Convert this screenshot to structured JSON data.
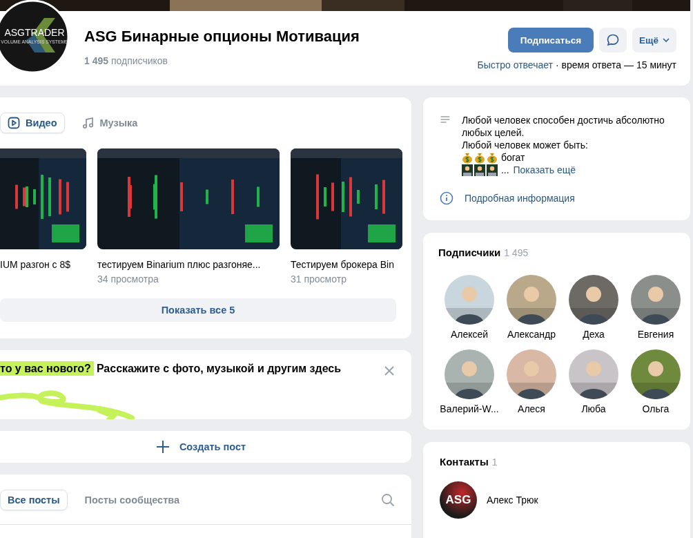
{
  "group": {
    "logo_text": "ASGTRADER",
    "logo_subtext": "VOLUME ANALYSIS SYSTEMS",
    "title": "ASG Бинарные опционы Мотивация",
    "members_count": "1 495",
    "members_label": "подписчиков",
    "subscribe": "Подписаться",
    "more": "Ещё",
    "reply_speed": "Быстро отвечает",
    "reply_time": "· время ответа — 15 минут"
  },
  "media": {
    "tabs": [
      {
        "label": "Видео",
        "kind": "video",
        "selected": true
      },
      {
        "label": "Музыка",
        "kind": "music",
        "selected": false
      }
    ],
    "videos": [
      {
        "title": "IUM разгон с 8$"
      },
      {
        "title": "тестируем Binarium плюс разгоняе...",
        "views": "34 просмотра"
      },
      {
        "title": "Тестируем брокера Bin",
        "views": "31 просмотр"
      }
    ],
    "show_all": "Показать все 5"
  },
  "prompt": {
    "highlight": "то у вас нового?",
    "text": "Расскажите с фото, музыкой и другим здесь"
  },
  "create_post": "Создать пост",
  "post_tabs": [
    {
      "label": "Все посты",
      "selected": true
    },
    {
      "label": "Посты сообщества",
      "selected": false
    }
  ],
  "about": {
    "text": "Любой человек способен достичь абсолютно любых целей.\nЛюбой человек может быть:",
    "emoji_lines": [
      {
        "icons": [
          {
            "kind": "money-bag"
          },
          {
            "kind": "money-bag"
          },
          {
            "kind": "money-bag"
          }
        ],
        "text": "богат"
      },
      {
        "icons": [
          {
            "kind": "laptop-person"
          },
          {
            "kind": "laptop-person"
          },
          {
            "kind": "laptop-person"
          }
        ],
        "text": "...",
        "link": "Показать ещё"
      }
    ],
    "details": "Подробная информация"
  },
  "subscribers": {
    "title": "Подписчики",
    "count": "1 495",
    "people": [
      {
        "name": "Алексей",
        "color": "#c9d6de"
      },
      {
        "name": "Александр",
        "color": "#b9a98a"
      },
      {
        "name": "Деха",
        "color": "#6d6a66"
      },
      {
        "name": "Евгения",
        "color": "#8a8f8c"
      },
      {
        "name": "Валерий-W...",
        "color": "#a9b4b0"
      },
      {
        "name": "Алеся",
        "color": "#d9b9a6"
      },
      {
        "name": "Люба",
        "color": "#c8c4c8"
      },
      {
        "name": "Ольга",
        "color": "#6f8a3c"
      }
    ]
  },
  "contacts": {
    "title": "Контакты",
    "count": "1",
    "people": [
      {
        "name": "Алекс Трюк",
        "avatar_text": "ASG"
      }
    ]
  }
}
